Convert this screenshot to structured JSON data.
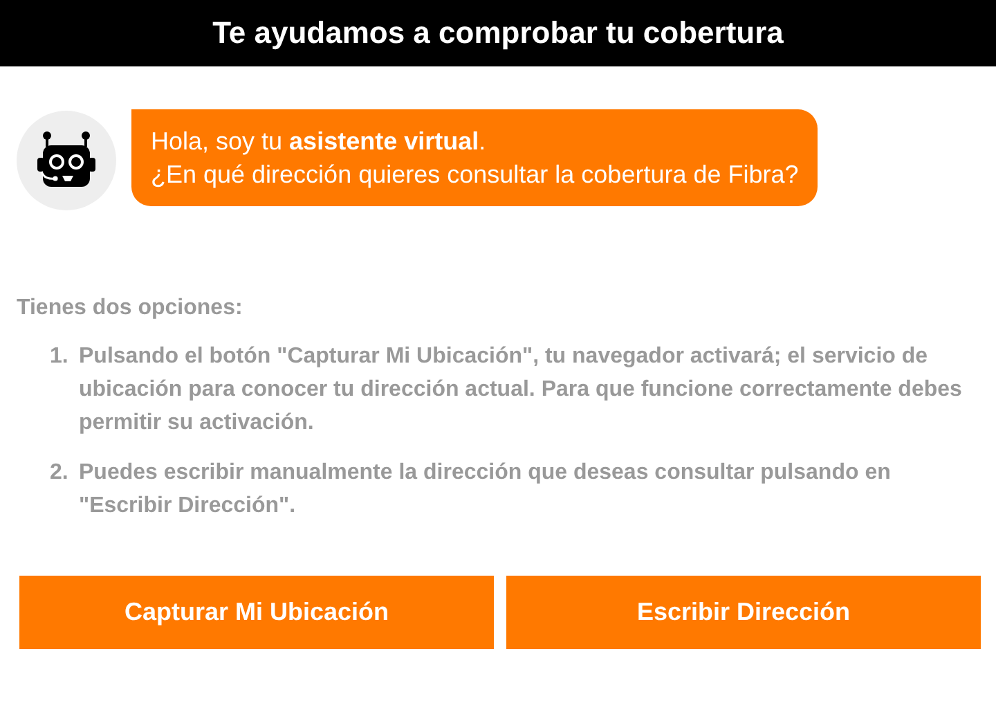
{
  "header": {
    "title": "Te ayudamos a comprobar tu cobertura"
  },
  "chat": {
    "message_lines": [
      "Hola, soy tu **asistente virtual**.",
      "¿En qué dirección quieres consultar la cobertura de Fibra?"
    ]
  },
  "intro": "Tienes dos opciones:",
  "options": [
    {
      "number": "1.",
      "text": "Pulsando el botón \"Capturar Mi Ubicación\", tu navegador activará; el servicio de ubicación para conocer tu dirección actual. Para que funcione correctamente debes permitir su activación."
    },
    {
      "number": "2.",
      "text": "Puedes escribir manualmente la dirección que deseas consultar pulsando en \"Escribir Dirección\"."
    }
  ],
  "buttons": [
    "Capturar Mi Ubicación",
    "Escribir Dirección"
  ]
}
